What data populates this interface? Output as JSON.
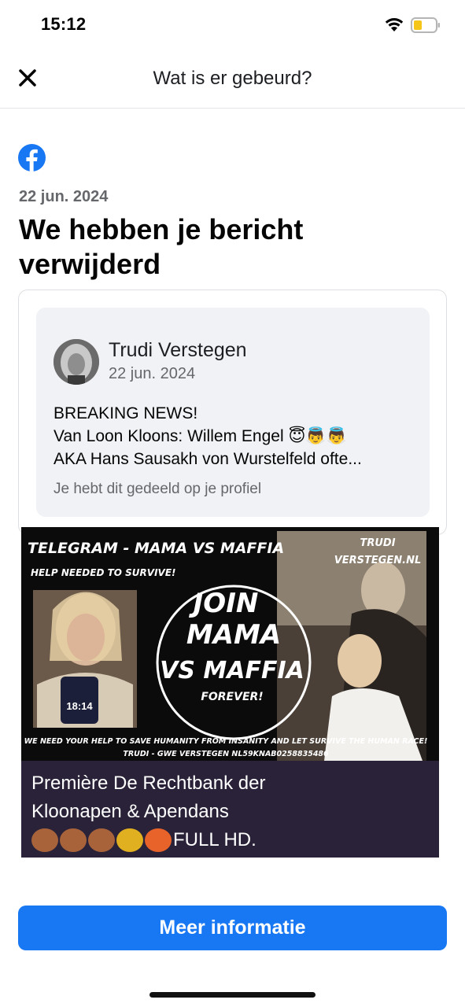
{
  "status_bar": {
    "time": "15:12",
    "icons": [
      "wifi-icon",
      "battery-low-icon"
    ]
  },
  "header": {
    "title": "Wat is er gebeurd?",
    "close_icon": "close-icon"
  },
  "notice": {
    "logo_icon": "facebook-logo-icon",
    "date": "22 jun. 2024",
    "title": "We hebben je bericht verwijderd"
  },
  "post": {
    "author": "Trudi Verstegen",
    "date": "22 jun. 2024",
    "text_lines": [
      "BREAKING NEWS!",
      "Van Loon Kloons: Willem Engel 😇👼👼",
      "AKA Hans Sausakh von Wurstelfeld ofte..."
    ],
    "shared_note": "Je hebt dit gedeeld op je profiel"
  },
  "media": {
    "image_texts": {
      "top_left": "TELEGRAM - MAMA VS MAFFIA",
      "help": "HELP NEEDED TO SURVIVE!",
      "brand_line1": "TRUDI",
      "brand_line2": "VERSTEGEN.NL",
      "circle_line1": "JOIN",
      "circle_line2": "MAMA",
      "circle_line3": "VS MAFFIA",
      "circle_line4": "FOREVER!",
      "phone_time": "18:14",
      "bottom_line1": "WE NEED YOUR HELP TO SAVE HUMANITY FROM INSANITY AND LET SURVIVE THE HUMAN RACE!",
      "bottom_line2": "TRUDI - GWE VERSTEGEN NL59KNAB0258835486"
    },
    "caption_line1": "Première De Rechtbank der",
    "caption_line2": "Kloonapen & Apendans",
    "caption_line3_text": "FULL HD."
  },
  "more_info_button": "Meer informatie",
  "colors": {
    "accent": "#1877f2",
    "caption_bg": "#2a2238"
  }
}
